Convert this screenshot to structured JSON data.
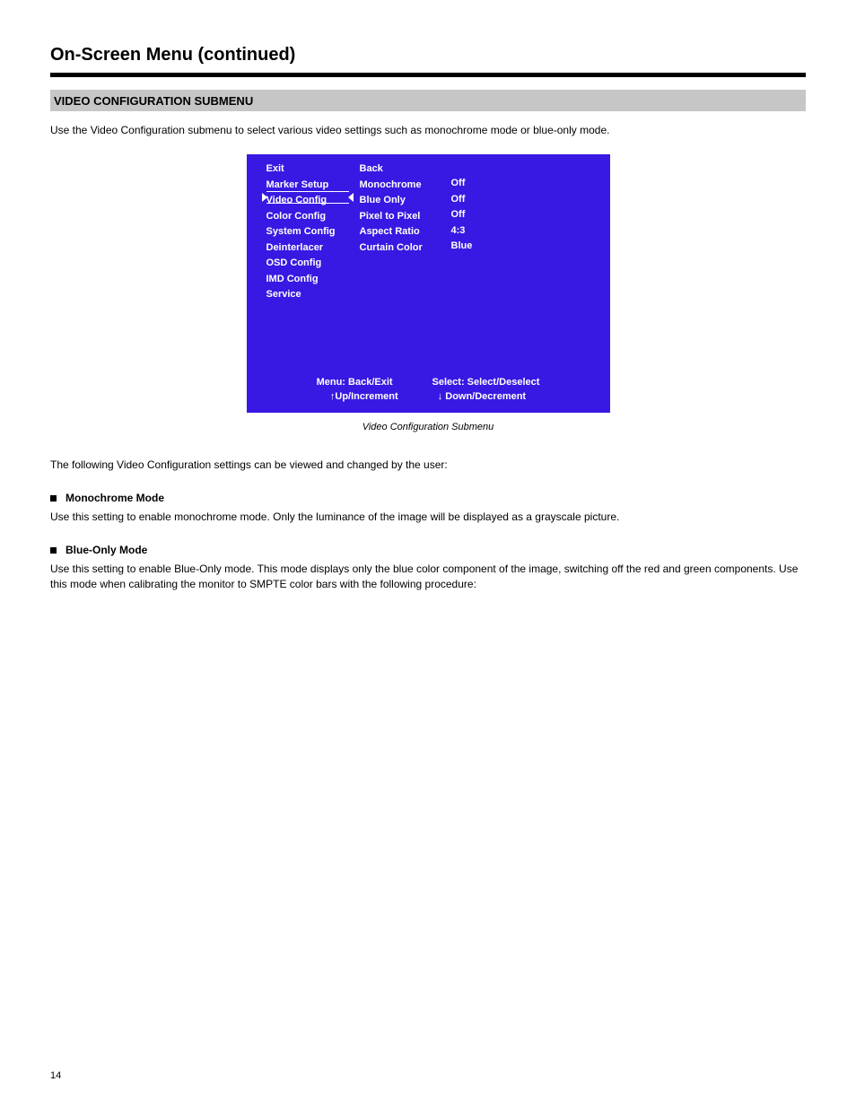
{
  "page": {
    "title": "On-Screen Menu (continued)",
    "section_bar": "VIDEO CONFIGURATION SUBMENU",
    "intro": "Use the Video Configuration submenu to select various video settings such as monochrome mode or blue-only mode.",
    "caption": "Video Configuration Submenu",
    "submenu_desc": "The following Video Configuration settings can be viewed and changed by the user:",
    "footer_left": "14",
    "footer_right": ""
  },
  "osd": {
    "left_items": [
      "Exit",
      "Marker Setup",
      "Video Config",
      "Color Config",
      "System Config",
      "Deinterlacer",
      "OSD Config",
      "IMD Config",
      "Service"
    ],
    "selected_index": 2,
    "mid_items": [
      "Back",
      "Monochrome",
      "Blue Only",
      "Pixel to Pixel",
      "Aspect Ratio",
      "Curtain Color"
    ],
    "right_items": [
      "Off",
      "Off",
      "Off",
      "4:3",
      "Blue"
    ],
    "footer": {
      "row1_left": "Menu: Back/Exit",
      "row1_right": "Select: Select/Deselect",
      "row2_left": "↑Up/Increment",
      "row2_right": "↓ Down/Decrement"
    }
  },
  "features": [
    {
      "title": "Monochrome Mode",
      "body": "Use this setting to enable monochrome mode. Only the luminance of the image will be displayed as a grayscale picture."
    },
    {
      "title": "Blue-Only Mode",
      "body": "Use this setting to enable Blue-Only mode. This mode displays only the blue color component of the image, switching off the red and green components. Use this mode when calibrating the monitor to SMPTE color bars with the following procedure:"
    }
  ]
}
